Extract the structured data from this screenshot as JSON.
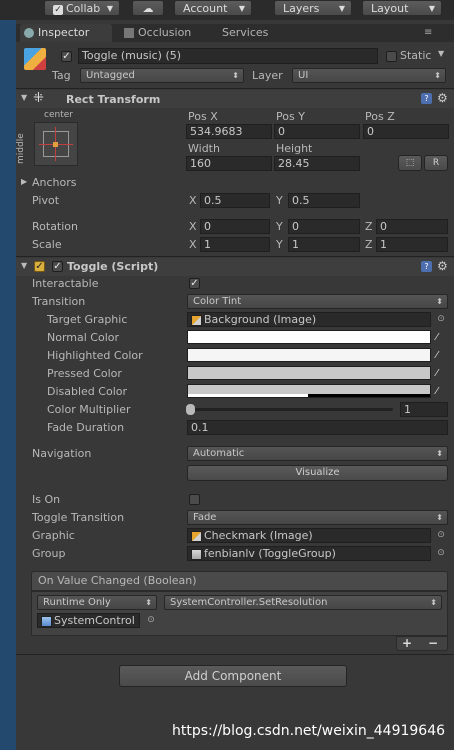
{
  "toolbar": {
    "collab": "Collab",
    "cloud_icon": "cloud-icon",
    "account": "Account",
    "layers": "Layers",
    "layout": "Layout"
  },
  "tabs": {
    "inspector": "Inspector",
    "occlusion": "Occlusion",
    "services": "Services"
  },
  "header": {
    "object_name": "Toggle (music) (5)",
    "static_label": "Static",
    "tag_label": "Tag",
    "tag_value": "Untagged",
    "layer_label": "Layer",
    "layer_value": "UI",
    "active": true,
    "static": false
  },
  "rect": {
    "title": "Rect Transform",
    "anchor_h": "center",
    "anchor_v": "middle",
    "posx_label": "Pos X",
    "posy_label": "Pos Y",
    "posz_label": "Pos Z",
    "posx": "534.9683",
    "posy": "0",
    "posz": "0",
    "width_label": "Width",
    "height_label": "Height",
    "width": "160",
    "height": "28.45",
    "r_button": "R",
    "anchors_label": "Anchors",
    "pivot_label": "Pivot",
    "pivot_x": "0.5",
    "pivot_y": "0.5",
    "rotation_label": "Rotation",
    "rot_x": "0",
    "rot_y": "0",
    "rot_z": "0",
    "scale_label": "Scale",
    "scale_x": "1",
    "scale_y": "1",
    "scale_z": "1",
    "x": "X",
    "y": "Y",
    "z": "Z"
  },
  "toggle": {
    "title": "Toggle (Script)",
    "interactable_label": "Interactable",
    "interactable": true,
    "transition_label": "Transition",
    "transition_value": "Color Tint",
    "target_graphic_label": "Target Graphic",
    "target_graphic_value": "Background (Image)",
    "normal_color_label": "Normal Color",
    "highlighted_color_label": "Highlighted Color",
    "pressed_color_label": "Pressed Color",
    "disabled_color_label": "Disabled Color",
    "normal_color": "#ffffff",
    "highlighted_color": "#f5f5f5",
    "pressed_color": "#c8c8c8",
    "disabled_color": "#c8c8c8",
    "color_multiplier_label": "Color Multiplier",
    "color_multiplier": "1",
    "fade_duration_label": "Fade Duration",
    "fade_duration": "0.1",
    "navigation_label": "Navigation",
    "navigation_value": "Automatic",
    "visualize_label": "Visualize",
    "is_on_label": "Is On",
    "is_on": false,
    "toggle_transition_label": "Toggle Transition",
    "toggle_transition_value": "Fade",
    "graphic_label": "Graphic",
    "graphic_value": "Checkmark (Image)",
    "group_label": "Group",
    "group_value": "fenbianlv (ToggleGroup)",
    "event_title": "On Value Changed (Boolean)",
    "runtime_value": "Runtime Only",
    "function_value": "SystemController.SetResolution",
    "target_object": "SystemControl",
    "plus": "+",
    "minus": "−"
  },
  "add_component": "Add Component",
  "watermark": "https://blog.csdn.net/weixin_44919646"
}
